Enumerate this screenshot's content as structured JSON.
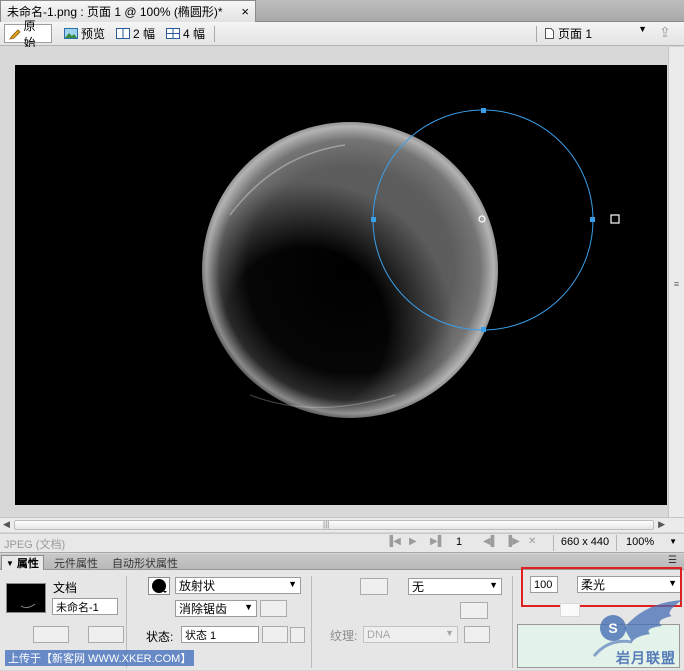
{
  "document_tab": {
    "title": "未命名-1.png : 页面 1 @ 100% (椭圆形)*",
    "close": "×"
  },
  "toolbar": {
    "original_label": "原始",
    "preview_label": "预览",
    "two_up_label": "2 幅",
    "four_up_label": "4 幅",
    "page_label": "页面 1"
  },
  "canvas": {
    "background": "#000000",
    "path_color": "#3a9ee8"
  },
  "status": {
    "file_info": "JPEG (文档)",
    "frame_number": "1",
    "image_size": "660 x 440",
    "zoom": "100%"
  },
  "panel_tabs": [
    "属性",
    "元件属性",
    "自动形状属性"
  ],
  "properties": {
    "object_type": "文档",
    "object_name": "未命名-1",
    "fill_type": "放射状",
    "edge": "消除锯齿",
    "state_label": "状态:",
    "state_value": "状态 1",
    "stroke_option": "无",
    "texture_label": "纹理:",
    "texture_value": "DNA",
    "opacity": "100",
    "blend_mode": "柔光"
  },
  "watermark": {
    "left_text": "上传于【新客网 WWW.XKER.COM】",
    "right_text": "岩月联盟"
  }
}
